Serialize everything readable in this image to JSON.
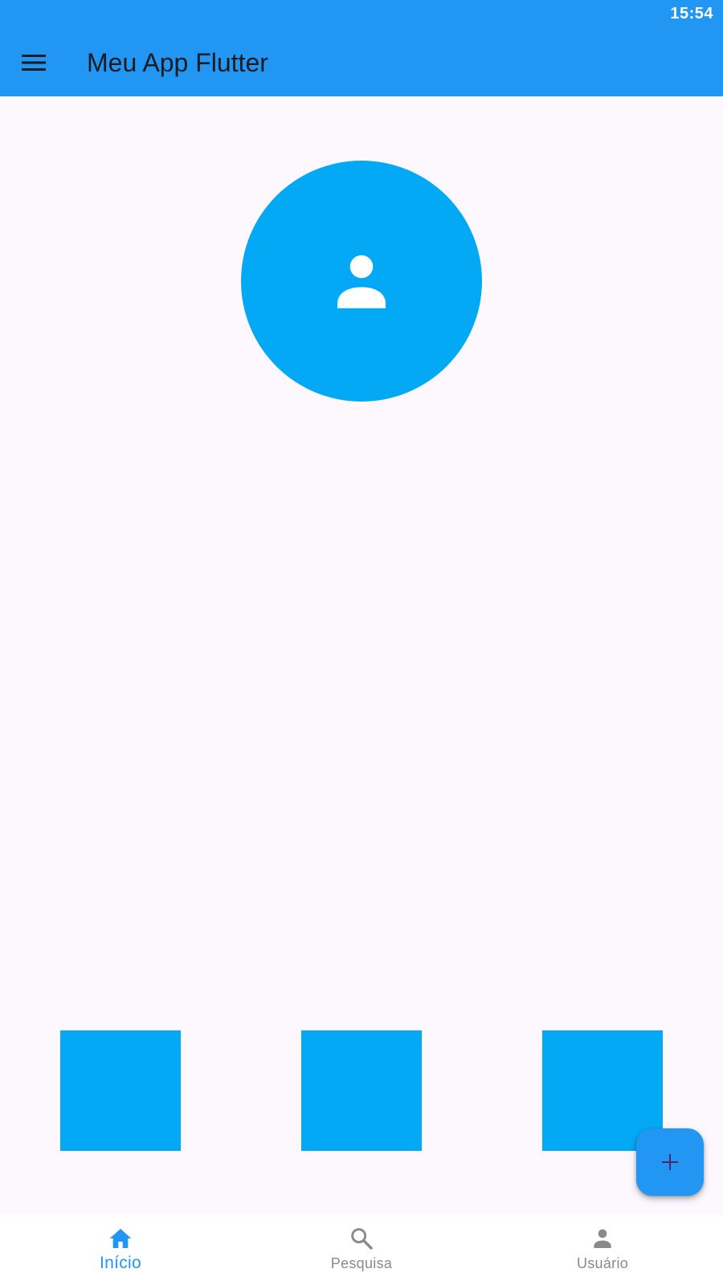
{
  "status_bar": {
    "time": "15:54"
  },
  "app_bar": {
    "title": "Meu App Flutter",
    "menu_icon": "menu-icon",
    "background_color": "#2196F3"
  },
  "avatar": {
    "icon": "person-icon",
    "color": "#03A9F4"
  },
  "tiles": [
    {
      "color": "#03A9F4"
    },
    {
      "color": "#03A9F4"
    },
    {
      "color": "#03A9F4"
    }
  ],
  "fab": {
    "icon": "add-icon",
    "color": "#2196F3"
  },
  "bottom_nav": {
    "active_index": 0,
    "active_color": "#2196F3",
    "inactive_color": "#8a8a8a",
    "items": [
      {
        "label": "Início",
        "icon": "home-icon"
      },
      {
        "label": "Pesquisa",
        "icon": "search-icon"
      },
      {
        "label": "Usuário",
        "icon": "person-icon"
      }
    ]
  }
}
